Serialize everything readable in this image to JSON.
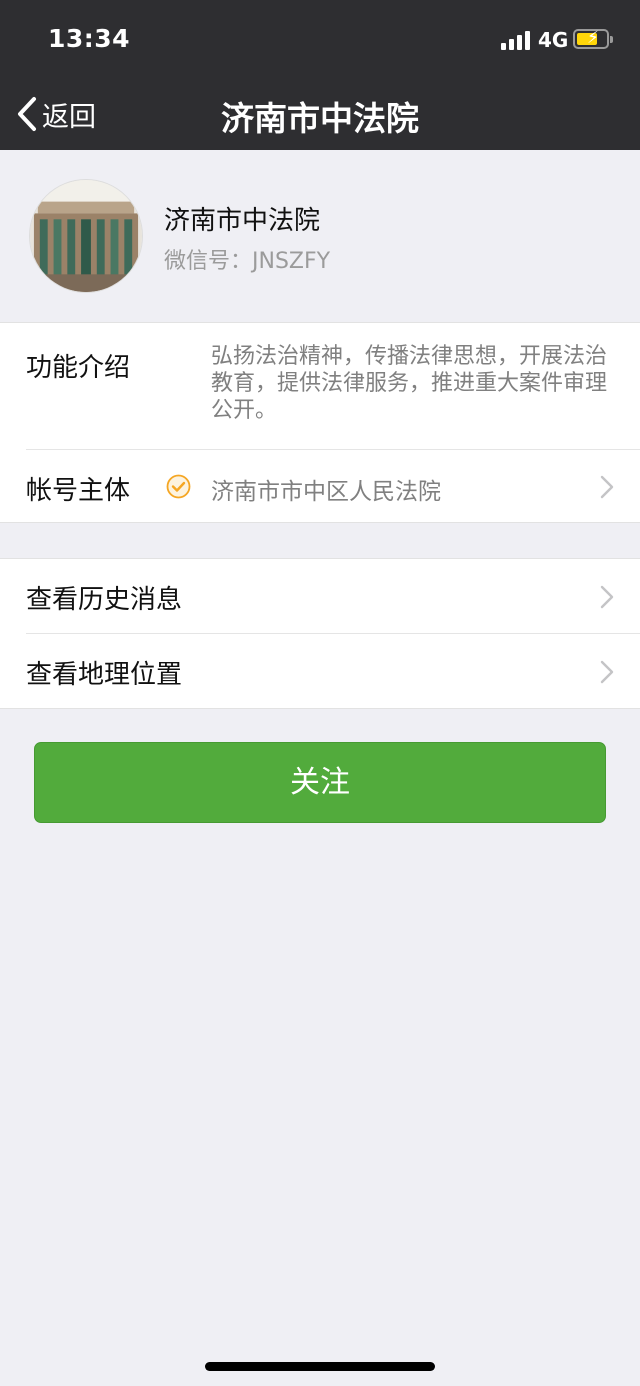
{
  "status_bar": {
    "time": "13:34",
    "network": "4G",
    "battery_charging": true
  },
  "nav": {
    "back_label": "返回",
    "title": "济南市中法院"
  },
  "profile": {
    "name": "济南市中法院",
    "wechat_id": "微信号：JNSZFY"
  },
  "info": {
    "intro_label": "功能介绍",
    "intro_text": "弘扬法治精神，传播法律思想，开展法治教育，提供法律服务，推进重大案件审理公开。",
    "entity_label": "帐号主体",
    "entity_value": "济南市市中区人民法院"
  },
  "actions": {
    "history_label": "查看历史消息",
    "location_label": "查看地理位置"
  },
  "follow_button": {
    "label": "关注"
  },
  "colors": {
    "nav_bg": "#2e2e31",
    "page_bg": "#efeff4",
    "follow_green": "#52ab3c",
    "verified_orange": "#f5a623"
  }
}
